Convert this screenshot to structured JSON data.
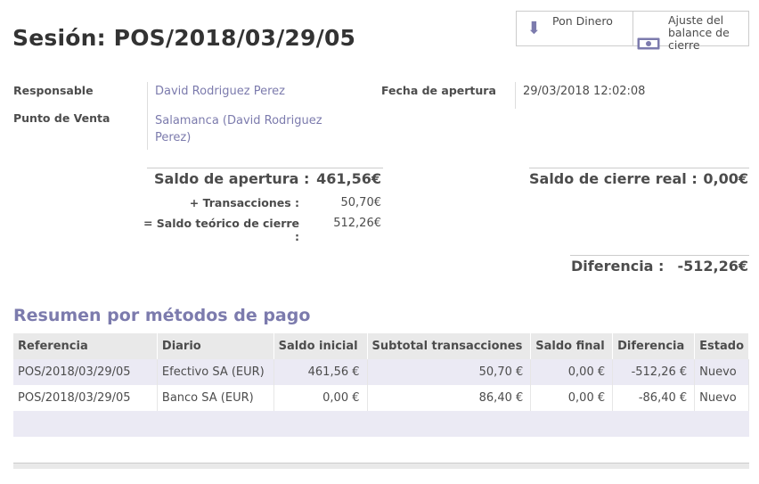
{
  "title": "Sesión: POS/2018/03/29/05",
  "buttons": {
    "put_money": "Pon Dinero",
    "adjust_balance": "Ajuste del balance de cierre"
  },
  "info": {
    "responsible_label": "Responsable",
    "responsible_value": "David Rodriguez Perez",
    "pos_label": "Punto de Venta",
    "pos_value": "Salamanca (David Rodriguez Perez)",
    "open_date_label": "Fecha de apertura",
    "open_date_value": "29/03/2018 12:02:08"
  },
  "totals": {
    "opening_label": "Saldo de apertura :",
    "opening_value": "461,56€",
    "transactions_label": "+ Transacciones :",
    "transactions_value": "50,70€",
    "theoretical_label": "= Saldo teórico de cierre :",
    "theoretical_value": "512,26€",
    "real_closing_label": "Saldo de cierre real :",
    "real_closing_value": "0,00€",
    "difference_label": "Diferencia :",
    "difference_value": "-512,26€"
  },
  "section_title": "Resumen por métodos de pago",
  "table": {
    "headers": [
      "Referencia",
      "Diario",
      "Saldo inicial",
      "Subtotal transacciones",
      "Saldo final",
      "Diferencia",
      "Estado"
    ],
    "rows": [
      [
        "POS/2018/03/29/05",
        "Efectivo SA (EUR)",
        "461,56 €",
        "50,70 €",
        "0,00 €",
        "-512,26 €",
        "Nuevo"
      ],
      [
        "POS/2018/03/29/05",
        "Banco SA (EUR)",
        "0,00 €",
        "86,40 €",
        "0,00 €",
        "-86,40 €",
        "Nuevo"
      ]
    ]
  },
  "colors": {
    "accent": "#7c7bad",
    "header_bg": "#e9e9e9",
    "row_bg": "#ebeaf4",
    "text": "#4c4c4c"
  },
  "icons": {
    "put_money": "arrow-down-icon",
    "adjust_balance": "money-icon"
  }
}
